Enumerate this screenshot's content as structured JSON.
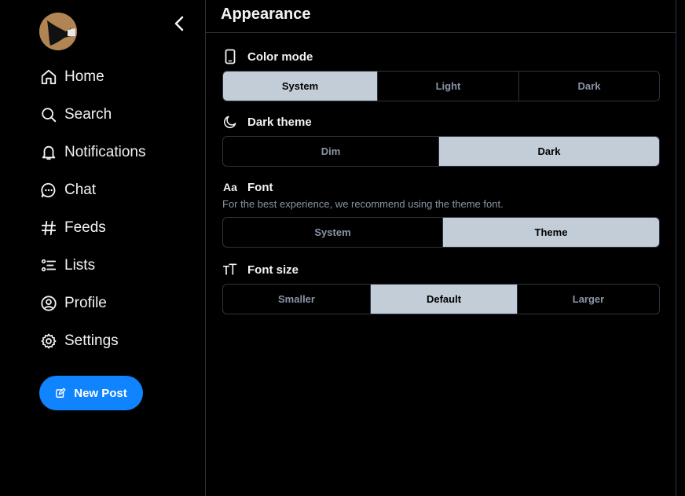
{
  "sidebar": {
    "nav": [
      {
        "label": "Home",
        "icon": "home-icon"
      },
      {
        "label": "Search",
        "icon": "search-icon"
      },
      {
        "label": "Notifications",
        "icon": "bell-icon"
      },
      {
        "label": "Chat",
        "icon": "chat-icon"
      },
      {
        "label": "Feeds",
        "icon": "hash-icon"
      },
      {
        "label": "Lists",
        "icon": "list-icon"
      },
      {
        "label": "Profile",
        "icon": "user-circle-icon"
      },
      {
        "label": "Settings",
        "icon": "gear-icon"
      }
    ],
    "new_post_label": "New Post"
  },
  "page": {
    "title": "Appearance"
  },
  "sections": {
    "color_mode": {
      "title": "Color mode",
      "options": [
        "System",
        "Light",
        "Dark"
      ],
      "selected": "System"
    },
    "dark_theme": {
      "title": "Dark theme",
      "options": [
        "Dim",
        "Dark"
      ],
      "selected": "Dark"
    },
    "font": {
      "icon_text": "Aa",
      "title": "Font",
      "description": "For the best experience, we recommend using the theme font.",
      "options": [
        "System",
        "Theme"
      ],
      "selected": "Theme"
    },
    "font_size": {
      "title": "Font size",
      "options": [
        "Smaller",
        "Default",
        "Larger"
      ],
      "selected": "Default"
    }
  },
  "colors": {
    "background": "#000000",
    "accent": "#1083fe",
    "selected_segment": "#c3cdd8",
    "border": "#2e3340",
    "muted_text": "#8a94a6"
  }
}
